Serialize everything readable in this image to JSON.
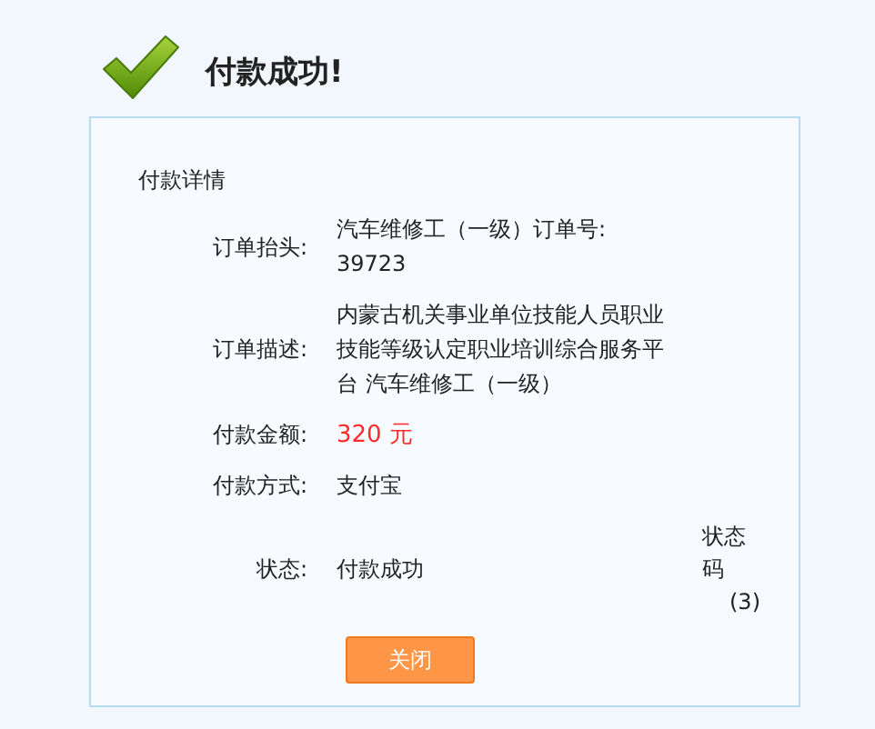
{
  "title": "付款成功!",
  "section_title": "付款详情",
  "rows": [
    {
      "kind": "text",
      "label": "订单抬头:",
      "value": "汽车维修工（一级）订单号: 39723"
    },
    {
      "kind": "text",
      "label": "订单描述:",
      "value": "内蒙古机关事业单位技能人员职业技能等级认定职业培训综合服务平台 汽车维修工（一级）"
    },
    {
      "kind": "amount",
      "label": "付款金额:",
      "value": "320 元"
    },
    {
      "kind": "text",
      "label": "付款方式:",
      "value": "支付宝"
    },
    {
      "kind": "status",
      "label": "状态:",
      "value": "付款成功",
      "code_label": "状态码",
      "code": "(3)"
    }
  ],
  "button": "关闭"
}
